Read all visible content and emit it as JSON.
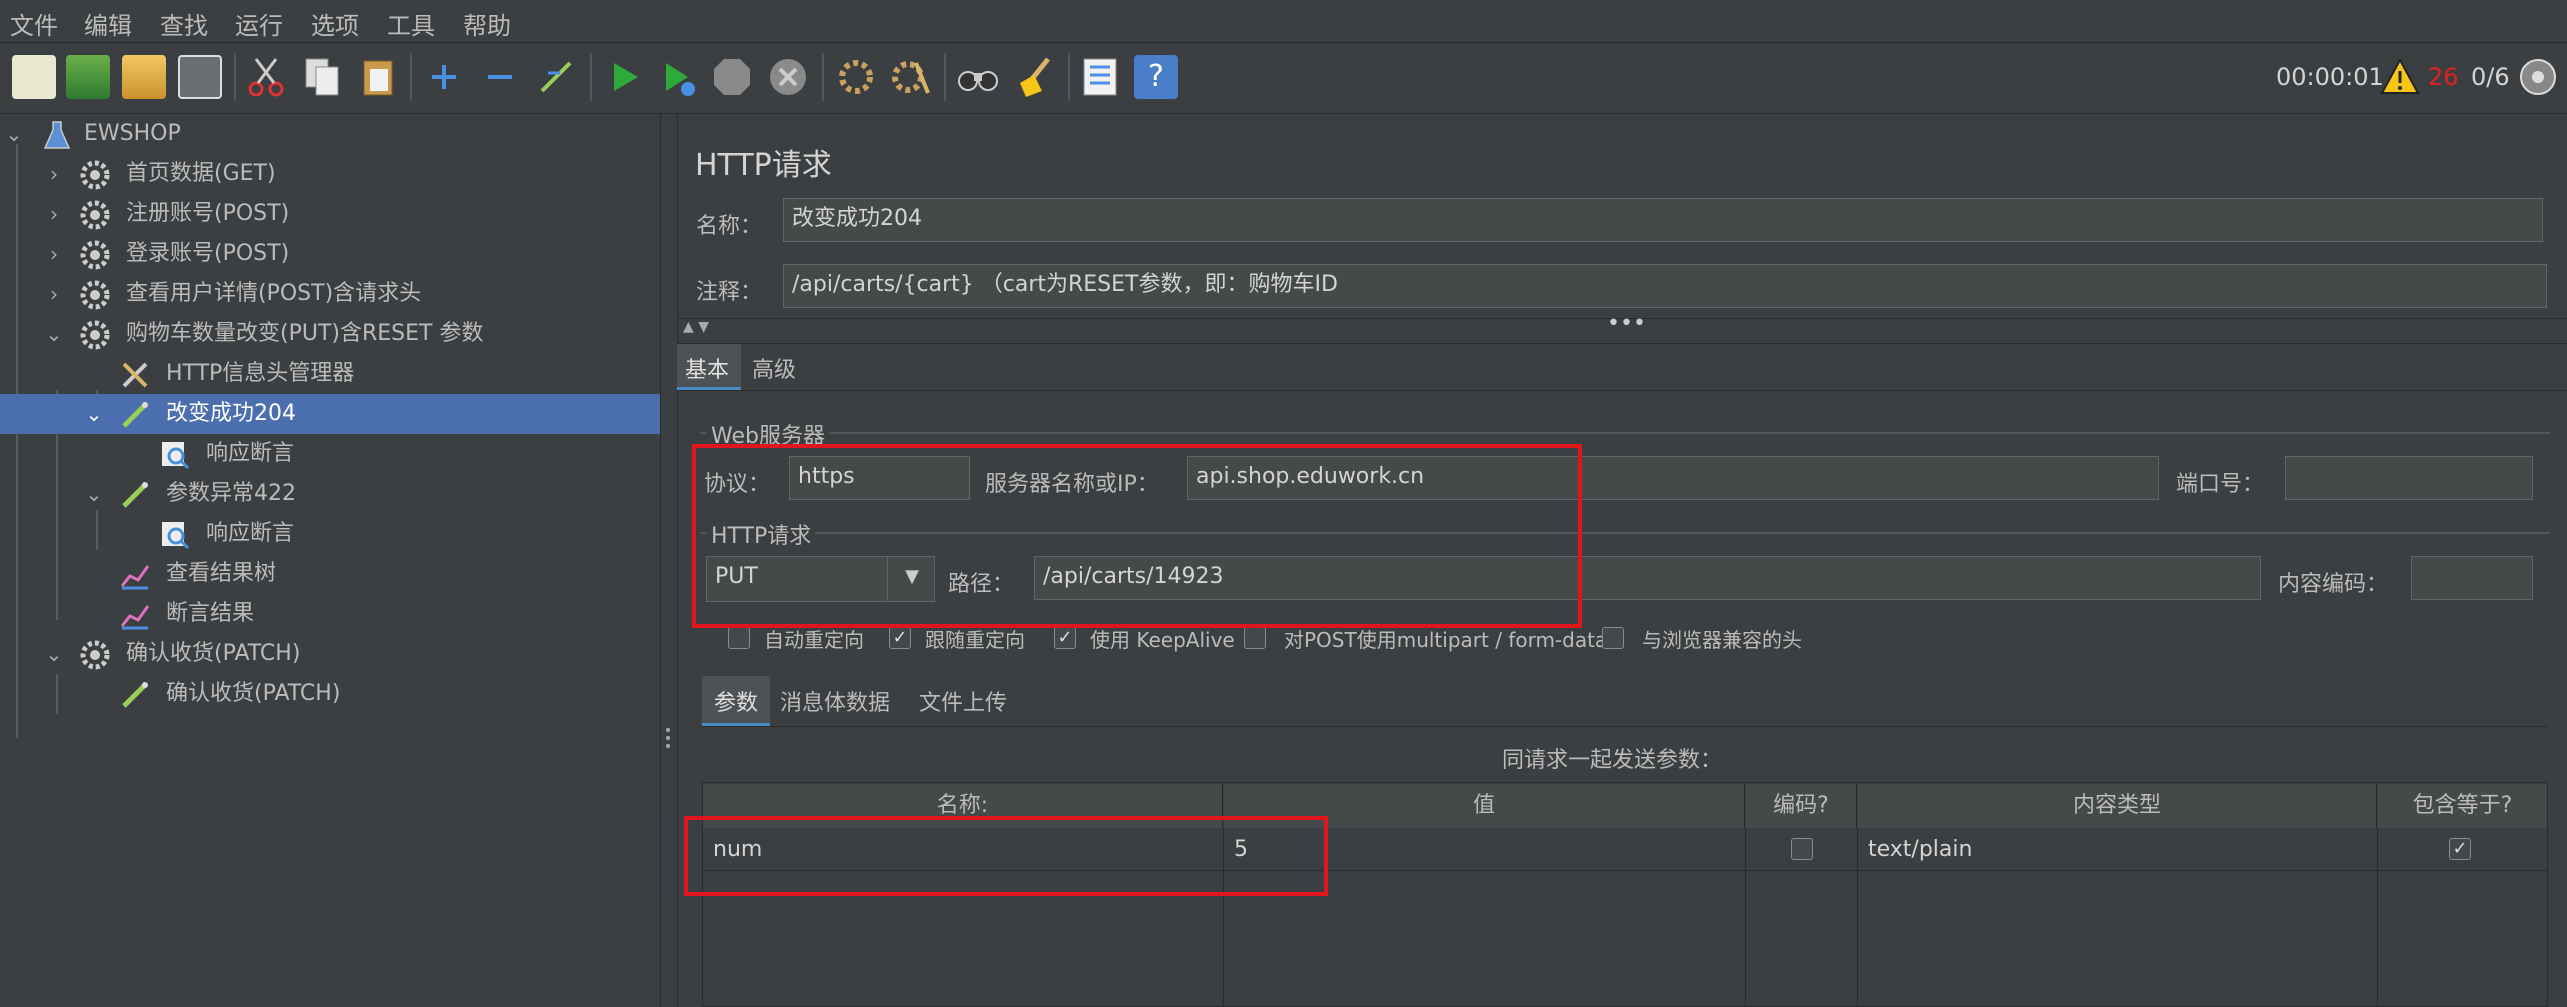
{
  "menu": [
    "文件",
    "编辑",
    "查找",
    "运行",
    "选项",
    "工具",
    "帮助"
  ],
  "toolbar": {
    "icons": [
      "new-icon",
      "templates-icon",
      "open-icon",
      "save-icon",
      "cut-icon",
      "copy-icon",
      "paste-icon",
      "expand-icon",
      "collapse-icon",
      "toggle-icon",
      "start-icon",
      "start-no-pause-icon",
      "stop-icon",
      "shutdown-icon",
      "clear-icon",
      "clear-all-icon",
      "search-icon",
      "reset-search-icon",
      "function-helper-icon",
      "help-icon"
    ],
    "timer": "00:00:01",
    "warn_count": "26",
    "threads": "0/6"
  },
  "tree": [
    {
      "label": "EWSHOP",
      "icon": "test-plan-icon"
    },
    {
      "label": "首页数据(GET)",
      "icon": "gear-icon"
    },
    {
      "label": "注册账号(POST)",
      "icon": "gear-icon"
    },
    {
      "label": "登录账号(POST)",
      "icon": "gear-icon"
    },
    {
      "label": "查看用户详情(POST)含请求头",
      "icon": "gear-icon"
    },
    {
      "label": "购物车数量改变(PUT)含RESET 参数",
      "icon": "gear-icon"
    },
    {
      "label": "HTTP信息头管理器",
      "icon": "tools-icon"
    },
    {
      "label": "改变成功204",
      "icon": "pipette-icon"
    },
    {
      "label": "响应断言",
      "icon": "magnifier-icon"
    },
    {
      "label": "参数异常422",
      "icon": "pipette-icon"
    },
    {
      "label": "响应断言",
      "icon": "magnifier-icon"
    },
    {
      "label": "查看结果树",
      "icon": "chart-icon"
    },
    {
      "label": "断言结果",
      "icon": "chart-icon"
    },
    {
      "label": "确认收货(PATCH)",
      "icon": "gear-icon"
    },
    {
      "label": "确认收货(PATCH)",
      "icon": "pipette-icon"
    }
  ],
  "panel": {
    "title": "HTTP请求",
    "name_label": "名称：",
    "name_value": "改变成功204",
    "comment_label": "注释：",
    "comment_value": "/api/carts/{cart} （cart为RESET参数，即：购物车ID",
    "tab_basic": "基本",
    "tab_advanced": "高级",
    "web_server_legend": "Web服务器",
    "protocol_label": "协议：",
    "protocol_value": "https",
    "server_label": "服务器名称或IP：",
    "server_value": "api.shop.eduwork.cn",
    "port_label": "端口号：",
    "port_value": "",
    "http_legend": "HTTP请求",
    "method_value": "PUT",
    "path_label": "路径：",
    "path_value": "/api/carts/14923",
    "encoding_label": "内容编码：",
    "encoding_value": "",
    "cb_auto_redirect": "自动重定向",
    "cb_follow_redirect": "跟随重定向",
    "cb_keepalive": "使用 KeepAlive",
    "cb_multipart": "对POST使用multipart / form-data",
    "cb_browser_headers": "与浏览器兼容的头",
    "sub_tab_params": "参数",
    "sub_tab_body": "消息体数据",
    "sub_tab_files": "文件上传",
    "params_caption": "同请求一起发送参数：",
    "col_name": "名称:",
    "col_value": "值",
    "col_encode": "编码?",
    "col_content_type": "内容类型",
    "col_include_equals": "包含等于?",
    "row_name": "num",
    "row_value": "5",
    "row_content_type": "text/plain"
  }
}
